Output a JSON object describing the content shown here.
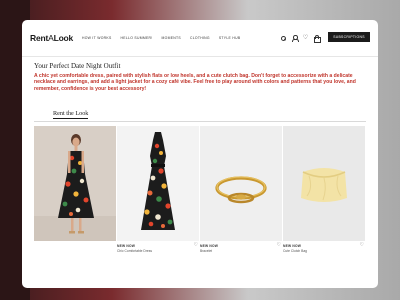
{
  "brand": {
    "logo_bold": "Rent",
    "logo_thin": "A",
    "logo_end": "Look"
  },
  "nav": {
    "items": [
      "HOW IT WORKS",
      "HELLO SUMMER!",
      "MOMENTS",
      "CLOTHING",
      "STYLE HUB"
    ],
    "subscriptions_label": "SUBSCRIPTIONS"
  },
  "icons": [
    "search-icon",
    "user-icon",
    "heart-icon",
    "bag-icon"
  ],
  "content": {
    "title": "Your Perfect Date Night Outfit",
    "description": "A chic yet comfortable dress, paired with stylish flats or low heels, and a cute clutch bag. Don't forget to accessorize with a delicate necklace and earrings, and add a light jacket for a cozy café vibe. Feel free to play around with colors and patterns that you love, and remember, confidence is your best accessory!",
    "rent_link": "Rent the Look"
  },
  "products": [
    {
      "badge": "",
      "name": ""
    },
    {
      "badge": "NEW NOW",
      "name": "Chic Comfortable Dress"
    },
    {
      "badge": "NEW NOW",
      "name": "Bracelet"
    },
    {
      "badge": "NEW NOW",
      "name": "Cute Clutch Bag"
    }
  ],
  "colors": {
    "accent": "#c0342b",
    "button": "#1b1b1b"
  }
}
